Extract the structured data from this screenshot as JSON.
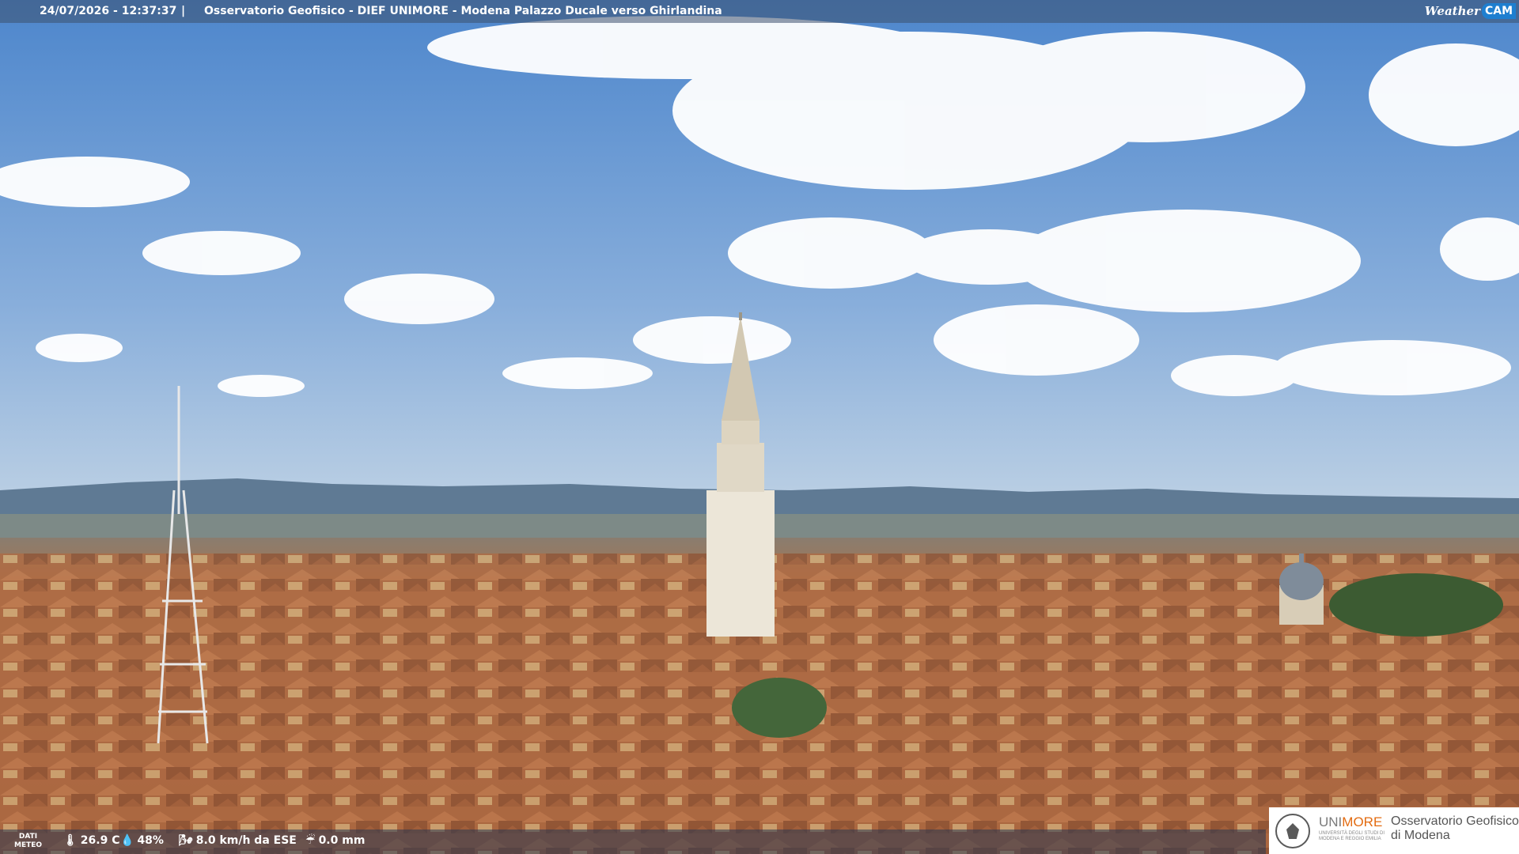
{
  "overlay": {
    "timestamp": "24/07/2026 - 12:37:37",
    "separator": "|",
    "title": "Osservatorio Geofisico - DIEF UNIMORE - Modena Palazzo Ducale verso Ghirlandina",
    "logo_weather": "Weather",
    "logo_cam": "CAM"
  },
  "weather": {
    "dati_meteo_line1": "DATI",
    "dati_meteo_line2": "METEO",
    "temperature": "26.9 C",
    "humidity": "48%",
    "wind": "8.0 km/h da ESE",
    "rain": "0.0 mm"
  },
  "icons": {
    "temperature": "thermometer-icon",
    "humidity": "drop-icon",
    "wind": "wind-icon",
    "rain": "rain-icon"
  },
  "branding": {
    "unimore_prefix": "UNI",
    "unimore_suffix": "MORE",
    "university": "UNIVERSITÀ DEGLI STUDI DI MODENA E REGGIO EMILIA",
    "observatory_line1": "Osservatorio Geofisico",
    "observatory_line2": "di Modena"
  },
  "colors": {
    "sky_top": "#4d86cc",
    "sky_bottom": "#a9c4e2",
    "roofs": "#b06a42",
    "unimore_orange": "#e36b10",
    "weathercam_blue": "#1e7fd0"
  }
}
